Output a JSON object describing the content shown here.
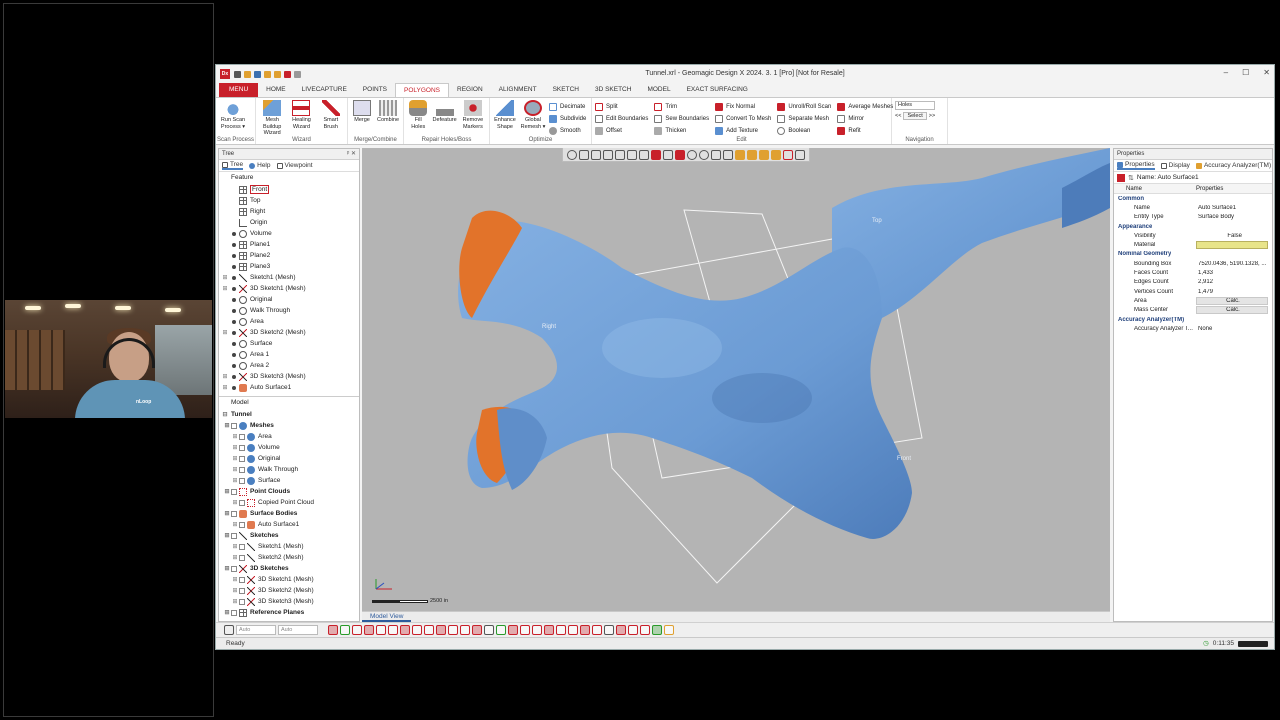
{
  "window": {
    "title": "Tunnel.xrl - Geomagic Design X 2024. 3. 1 [Pro] [Not for Resale]",
    "app_logo": "Dx",
    "minimize": "–",
    "maximize": "☐",
    "close": "✕"
  },
  "ribbon_tabs": [
    "MENU",
    "HOME",
    "LIVECAPTURE",
    "POINTS",
    "POLYGONS",
    "REGION",
    "ALIGNMENT",
    "SKETCH",
    "3D SKETCH",
    "MODEL",
    "EXACT SURFACING"
  ],
  "ribbon_active_tab": "POLYGONS",
  "ribbon": {
    "scan_process": {
      "label": "Scan Process",
      "buttons": [
        "Run Scan Process ▾"
      ]
    },
    "wizard": {
      "label": "Wizard",
      "buttons": [
        "Mesh Buildup Wizard",
        "Healing Wizard",
        "Smart Brush"
      ]
    },
    "merge_combine": {
      "label": "Merge/Combine",
      "buttons": [
        "Merge",
        "Combine"
      ]
    },
    "repair": {
      "label": "Repair Holes/Boss",
      "buttons": [
        "Fill Holes",
        "Defeature",
        "Remove Markers"
      ]
    },
    "optimize": {
      "label": "Optimize",
      "buttons": [
        "Enhance Shape",
        "Global Remesh ▾"
      ],
      "small": [
        "Decimate",
        "Subdivide",
        "Smooth"
      ]
    },
    "edit": {
      "label": "Edit",
      "col1": [
        "Split",
        "Edit Boundaries",
        "Offset"
      ],
      "col2": [
        "Trim",
        "Sew Boundaries",
        "Thicken"
      ],
      "col3": [
        "Fix Normal",
        "Convert To Mesh",
        "Add Texture"
      ],
      "col4": [
        "Unroll/Roll Scan",
        "Separate Mesh",
        "Boolean"
      ],
      "col5": [
        "Average Meshes",
        "Mirror",
        "Refit"
      ]
    },
    "navigation": {
      "label": "Navigation",
      "dropdown": "Holes",
      "prev": "<<",
      "select": "Select",
      "next": ">>"
    }
  },
  "tree_panel": {
    "title": "Tree",
    "tabs": [
      "Tree",
      "Help",
      "Viewpoint"
    ],
    "feature_label": "Feature",
    "features": [
      {
        "label": "Front",
        "icon": "plane-icon",
        "selected": true
      },
      {
        "label": "Top",
        "icon": "plane-icon"
      },
      {
        "label": "Right",
        "icon": "plane-icon"
      },
      {
        "label": "Origin",
        "icon": "origin-icon"
      },
      {
        "label": "Volume",
        "icon": "region-icon"
      },
      {
        "label": "Plane1",
        "icon": "plane-icon"
      },
      {
        "label": "Plane2",
        "icon": "plane-icon"
      },
      {
        "label": "Plane3",
        "icon": "plane-icon"
      },
      {
        "label": "Sketch1 (Mesh)",
        "icon": "sketch-icon",
        "expand": true
      },
      {
        "label": "3D Sketch1 (Mesh)",
        "icon": "sketch3d-icon",
        "expand": true
      },
      {
        "label": "Original",
        "icon": "region-icon"
      },
      {
        "label": "Walk Through",
        "icon": "region-icon"
      },
      {
        "label": "Area",
        "icon": "region-icon"
      },
      {
        "label": "3D Sketch2 (Mesh)",
        "icon": "sketch3d-icon",
        "expand": true
      },
      {
        "label": "Surface",
        "icon": "region-icon"
      },
      {
        "label": "Area 1",
        "icon": "region-icon"
      },
      {
        "label": "Area 2",
        "icon": "region-icon"
      },
      {
        "label": "3D Sketch3 (Mesh)",
        "icon": "sketch3d-icon",
        "expand": true
      },
      {
        "label": "Auto Surface1",
        "icon": "surface-icon",
        "expand": true
      }
    ],
    "model_label": "Model",
    "model_root": "Tunnel",
    "model_tree": [
      {
        "label": "Meshes",
        "bold": true,
        "level": 1,
        "icon": "mesh-icon"
      },
      {
        "label": "Area",
        "level": 2,
        "icon": "mesh-icon"
      },
      {
        "label": "Volume",
        "level": 2,
        "icon": "mesh-icon"
      },
      {
        "label": "Original",
        "level": 2,
        "icon": "mesh-icon"
      },
      {
        "label": "Walk Through",
        "level": 2,
        "icon": "mesh-icon"
      },
      {
        "label": "Surface",
        "level": 2,
        "icon": "mesh-icon"
      },
      {
        "label": "Point Clouds",
        "bold": true,
        "level": 1,
        "icon": "pointcloud-icon"
      },
      {
        "label": "Copied Point Cloud",
        "level": 2,
        "icon": "pointcloud-icon"
      },
      {
        "label": "Surface Bodies",
        "bold": true,
        "level": 1,
        "icon": "surface-icon"
      },
      {
        "label": "Auto Surface1",
        "level": 2,
        "icon": "surface-icon"
      },
      {
        "label": "Sketches",
        "bold": true,
        "level": 1,
        "icon": "sketch-icon"
      },
      {
        "label": "Sketch1 (Mesh)",
        "level": 2,
        "icon": "sketch-icon"
      },
      {
        "label": "Sketch2 (Mesh)",
        "level": 2,
        "icon": "sketch-icon"
      },
      {
        "label": "3D Sketches",
        "bold": true,
        "level": 1,
        "icon": "sketch3d-icon"
      },
      {
        "label": "3D Sketch1 (Mesh)",
        "level": 2,
        "icon": "sketch3d-icon"
      },
      {
        "label": "3D Sketch2 (Mesh)",
        "level": 2,
        "icon": "sketch3d-icon"
      },
      {
        "label": "3D Sketch3 (Mesh)",
        "level": 2,
        "icon": "sketch3d-icon"
      },
      {
        "label": "Reference Planes",
        "bold": true,
        "level": 1,
        "icon": "plane-icon"
      }
    ]
  },
  "viewport": {
    "labels": {
      "right": "Right",
      "top": "Top",
      "front": "Front"
    },
    "scale": "2500 in",
    "tab": "Model View",
    "colors": {
      "mesh": "#6f9fd8",
      "mesh_dark": "#4a78b4",
      "highlight": "#e2732a",
      "background": "#b4b4b4"
    }
  },
  "properties": {
    "title": "Properties",
    "tabs": [
      "Properties",
      "Display",
      "Accuracy Analyzer(TM)"
    ],
    "name_field": "Name: Auto Surface1",
    "col_name": "Name",
    "col_props": "Properties",
    "rows": [
      {
        "type": "cat",
        "name": "Common"
      },
      {
        "name": "Name",
        "value": "Auto Surface1"
      },
      {
        "name": "Entity Type",
        "value": "Surface Body"
      },
      {
        "type": "cat",
        "name": "Appearance"
      },
      {
        "name": "Visibility",
        "value": "False",
        "align": "right"
      },
      {
        "name": "Material",
        "value": "",
        "swatch": true
      },
      {
        "type": "cat",
        "name": "Nominal Geometry"
      },
      {
        "name": "Bounding Box",
        "value": "7520.0436, 5190.1328, ...",
        "expand": true
      },
      {
        "name": "Faces Count",
        "value": "1,433"
      },
      {
        "name": "Edges Count",
        "value": "2,912"
      },
      {
        "name": "Vertices Count",
        "value": "1,479"
      },
      {
        "name": "Area",
        "value": "Calc.",
        "button": true
      },
      {
        "name": "Mass Center",
        "value": "Calc.",
        "button": true,
        "expand": true
      },
      {
        "type": "cat",
        "name": "Accuracy Analyzer(TM)"
      },
      {
        "name": "Accuracy Analyzer T...",
        "value": "None"
      }
    ]
  },
  "bottom_toolbar": {
    "select1": "Auto",
    "select2": "Auto"
  },
  "status": {
    "text": "Ready",
    "time": "0:11:35"
  },
  "webcam": {
    "shirt_logo": "nLoop"
  }
}
